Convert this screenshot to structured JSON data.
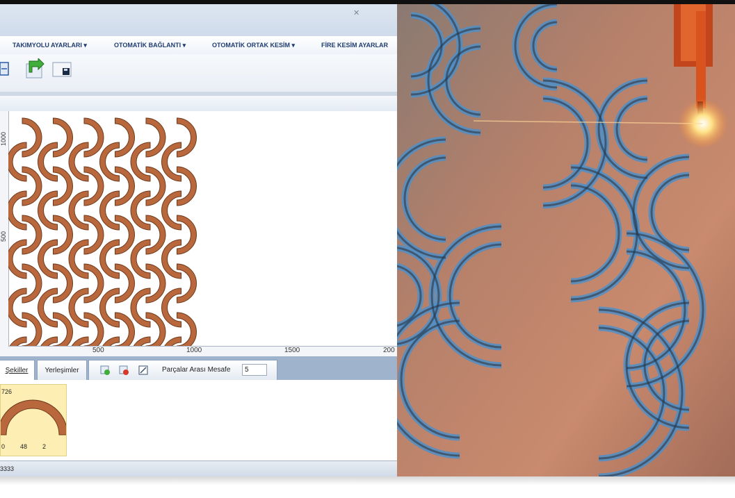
{
  "menubar": {
    "items": [
      {
        "label": "TAKIMYOLU AYARLARI ▾"
      },
      {
        "label": "OTOMATİK BAĞLANTI ▾"
      },
      {
        "label": "OTOMATİK ORTAK KESİM ▾"
      },
      {
        "label": "FİRE KESİM AYARLAR"
      }
    ]
  },
  "toolbar": {
    "icons": [
      "arrange-icon",
      "refresh-arrow-icon",
      "save-disk-icon"
    ]
  },
  "canvas": {
    "x_ticks": [
      "500",
      "1000",
      "1500",
      "200"
    ],
    "y_ticks": [
      "1000",
      "500"
    ],
    "part_color": "#b8683c",
    "part_outline": "#6e3a1c"
  },
  "tabs": {
    "shapes": "Şekiller",
    "layouts": "Yerleşimler",
    "spacing_label": "Parçalar Arası Mesafe",
    "spacing_value": "5",
    "icons": [
      "add-part-icon",
      "remove-part-icon",
      "part-settings-icon"
    ]
  },
  "shape_card": {
    "id": "726",
    "values": [
      "0",
      "48",
      "2"
    ],
    "bg_color": "#fdefb4"
  },
  "status": {
    "text": "3333"
  },
  "photo": {
    "description_icon": "plasma-cutter-photo"
  }
}
